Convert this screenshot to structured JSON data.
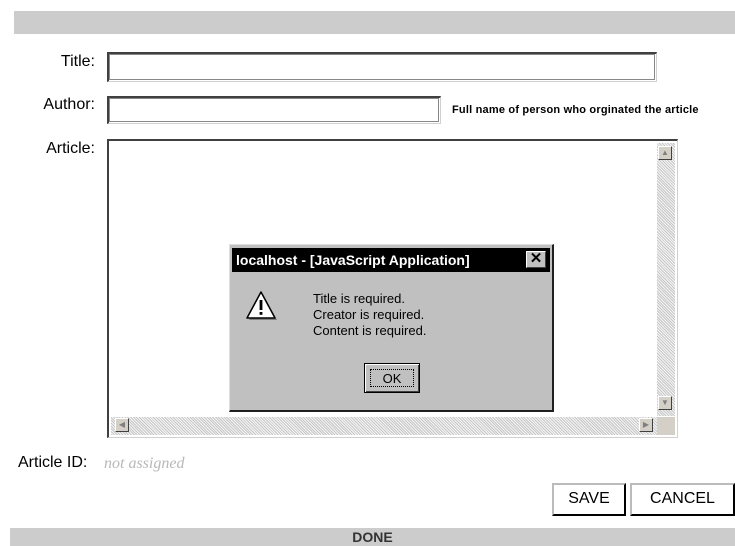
{
  "form": {
    "title_label": "Title:",
    "title_value": "",
    "author_label": "Author:",
    "author_value": "",
    "author_hint": "Full name of person who orginated the article",
    "article_label": "Article:",
    "article_value": "",
    "article_id_label": "Article ID:",
    "article_id_value": "not assigned"
  },
  "dialog": {
    "title": "localhost - [JavaScript Application]",
    "close_glyph": "✕",
    "icon": "warning-icon",
    "messages": [
      "Title is required.",
      "Creator is required.",
      "Content is required."
    ],
    "ok_label": "OK"
  },
  "scrollbar": {
    "up_glyph": "▲",
    "down_glyph": "▼",
    "left_glyph": "◀",
    "right_glyph": "▶"
  },
  "buttons": {
    "save_label": "SAVE",
    "cancel_label": "CANCEL"
  },
  "status": {
    "text": "DONE"
  }
}
